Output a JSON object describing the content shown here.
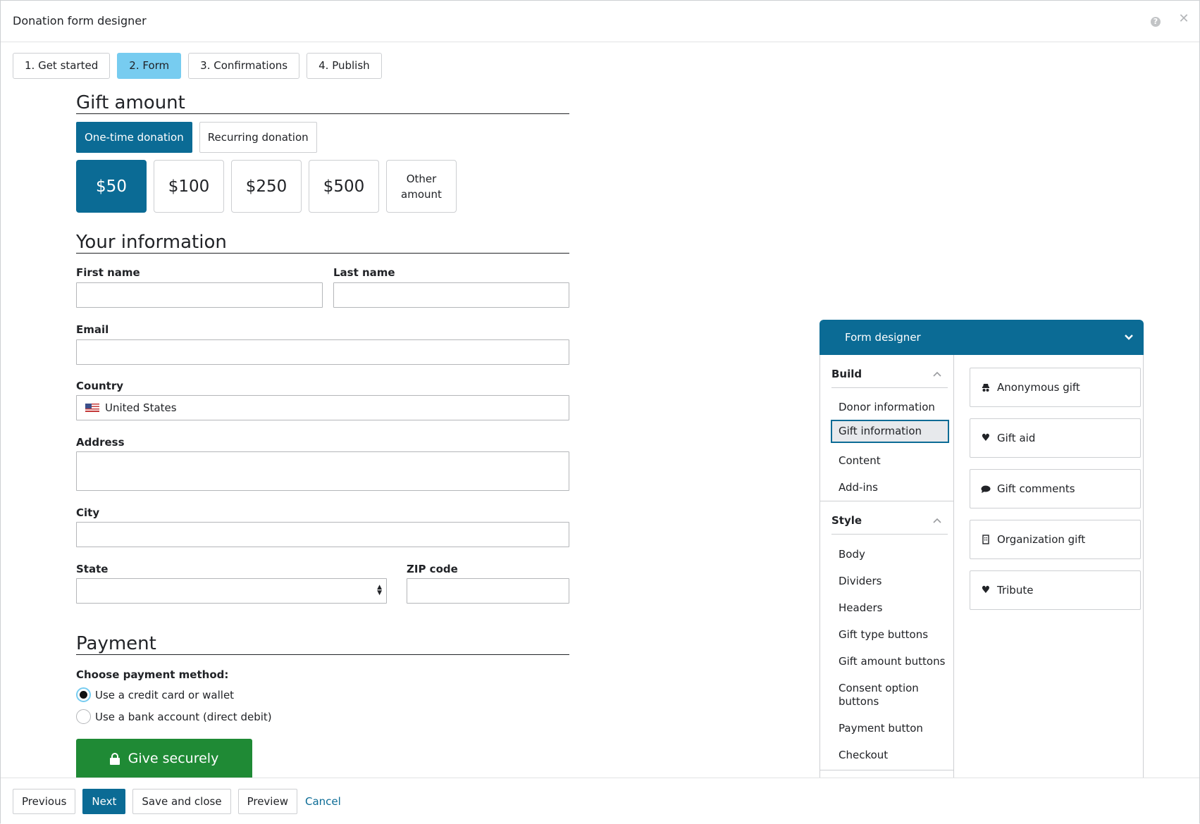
{
  "dialog": {
    "title": "Donation form designer",
    "help_icon": "help-icon",
    "close_icon": "close-icon"
  },
  "tabs": [
    {
      "label": "1. Get started",
      "active": false
    },
    {
      "label": "2. Form",
      "active": true
    },
    {
      "label": "3. Confirmations",
      "active": false
    },
    {
      "label": "4. Publish",
      "active": false
    }
  ],
  "gift_amount": {
    "title": "Gift amount",
    "types": [
      "One-time donation",
      "Recurring donation"
    ],
    "selected_type": "One-time donation",
    "amounts": [
      "$50",
      "$100",
      "$250",
      "$500"
    ],
    "other_line1": "Other",
    "other_line2": "amount",
    "selected_amount": "$50"
  },
  "your_info": {
    "title": "Your information",
    "first_name_label": "First name",
    "last_name_label": "Last name",
    "email_label": "Email",
    "country_label": "Country",
    "country_value": "United States",
    "address_label": "Address",
    "city_label": "City",
    "state_label": "State",
    "zip_label": "ZIP code"
  },
  "payment": {
    "title": "Payment",
    "choose_label": "Choose payment method:",
    "options": [
      "Use a credit card or wallet",
      "Use a bank account (direct debit)"
    ],
    "selected": "Use a credit card or wallet",
    "give_label": "Give securely"
  },
  "designer": {
    "title": "Form designer",
    "build_heading": "Build",
    "build_items": [
      "Donor information",
      "Gift information",
      "Content",
      "Add-ins"
    ],
    "selected_item": "Gift information",
    "style_heading": "Style",
    "style_items": [
      "Body",
      "Dividers",
      "Headers",
      "Gift type buttons",
      "Gift amount buttons",
      "Consent option buttons",
      "Payment button",
      "Checkout"
    ],
    "components": [
      {
        "label": "Anonymous gift",
        "icon": "incognito-icon"
      },
      {
        "label": "Gift aid",
        "icon": "heart-icon"
      },
      {
        "label": "Gift comments",
        "icon": "comment-icon"
      },
      {
        "label": "Organization gift",
        "icon": "building-icon"
      },
      {
        "label": "Tribute",
        "icon": "heart-icon"
      }
    ]
  },
  "footer": {
    "previous": "Previous",
    "next": "Next",
    "save_close": "Save and close",
    "preview": "Preview",
    "cancel": "Cancel"
  },
  "colors": {
    "primary": "#0b6b95",
    "active_tab": "#77ccf0",
    "give_button": "#1f8a35"
  }
}
